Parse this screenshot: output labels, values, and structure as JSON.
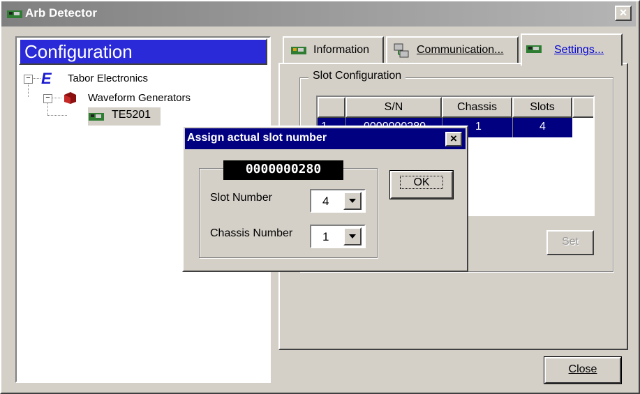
{
  "window": {
    "title": "Arb Detector",
    "close_glyph": "×"
  },
  "left_panel": {
    "header": "Configuration",
    "tree": {
      "root": "Tabor Electronics",
      "child": "Waveform Generators",
      "leaf": "TE5201"
    }
  },
  "tabs": [
    {
      "label": "Information"
    },
    {
      "label": "Communication..."
    },
    {
      "label": "Settings..."
    }
  ],
  "slot_config": {
    "group_label": "Slot Configuration",
    "columns": [
      "",
      "S/N",
      "Chassis",
      "Slots"
    ],
    "row": {
      "index": "1",
      "sn": "0000000280",
      "chassis": "1",
      "slots": "4"
    },
    "set_button": "Set"
  },
  "close_button": "Close",
  "dialog": {
    "title": "Assign actual slot number",
    "serial": "0000000280",
    "slot_label": "Slot Number",
    "slot_value": "4",
    "chassis_label": "Chassis Number",
    "chassis_value": "1",
    "ok_button": "OK"
  },
  "colors": {
    "header_blue": "#2a2ad8",
    "selected_row": "#000080",
    "window_face": "#d4d0c8"
  },
  "icons": {
    "window": "board-icon",
    "tabor": "tabor-logo-icon",
    "generator": "cube-icon",
    "device": "board-icon"
  }
}
